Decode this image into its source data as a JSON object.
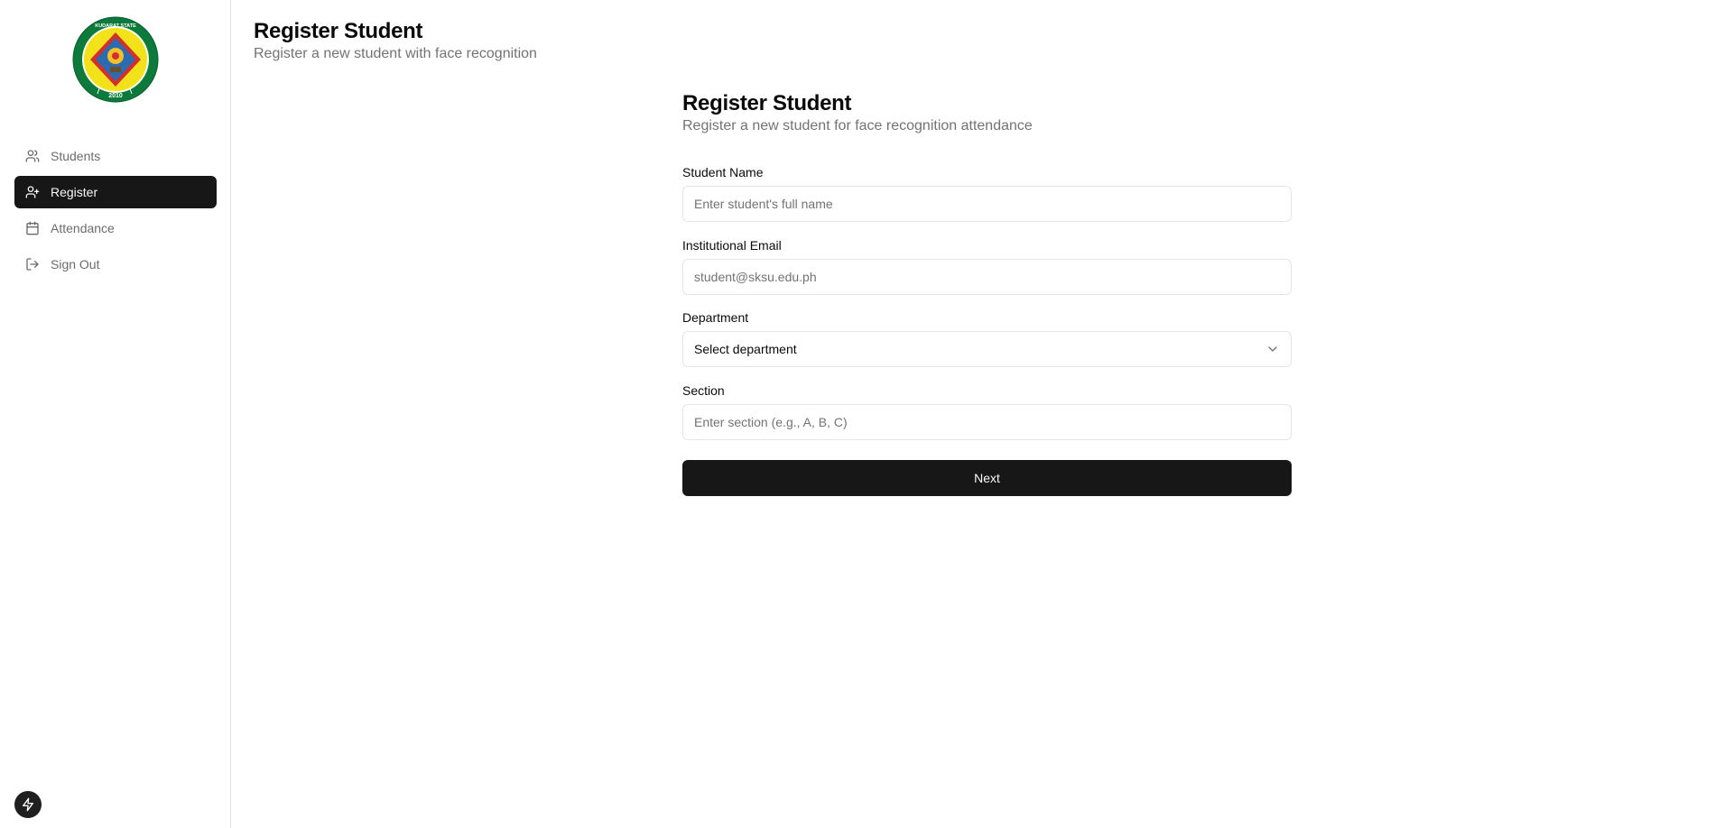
{
  "sidebar": {
    "logo": {
      "ring_text_top": "SULTAN KUDARAT STATE UNIVERSITY",
      "year": "2010",
      "colors": {
        "ring": "#0b7a3b",
        "inner": "#f2e21a",
        "diamond": "#d32f2f",
        "center": "#2b6cb0"
      }
    },
    "items": [
      {
        "label": "Students",
        "icon": "users-icon",
        "active": false
      },
      {
        "label": "Register",
        "icon": "user-plus-icon",
        "active": true
      },
      {
        "label": "Attendance",
        "icon": "calendar-icon",
        "active": false
      },
      {
        "label": "Sign Out",
        "icon": "log-out-icon",
        "active": false
      }
    ]
  },
  "header": {
    "title": "Register Student",
    "subtitle": "Register a new student with face recognition"
  },
  "form": {
    "title": "Register Student",
    "subtitle": "Register a new student for face recognition attendance",
    "student_name": {
      "label": "Student Name",
      "placeholder": "Enter student's full name",
      "value": ""
    },
    "email": {
      "label": "Institutional Email",
      "placeholder": "student@sksu.edu.ph",
      "value": ""
    },
    "department": {
      "label": "Department",
      "selected": "Select department"
    },
    "section": {
      "label": "Section",
      "placeholder": "Enter section (e.g., A, B, C)",
      "value": ""
    },
    "next_label": "Next"
  },
  "colors": {
    "primary": "#171717",
    "muted": "#737373",
    "border": "#e5e5e5"
  }
}
